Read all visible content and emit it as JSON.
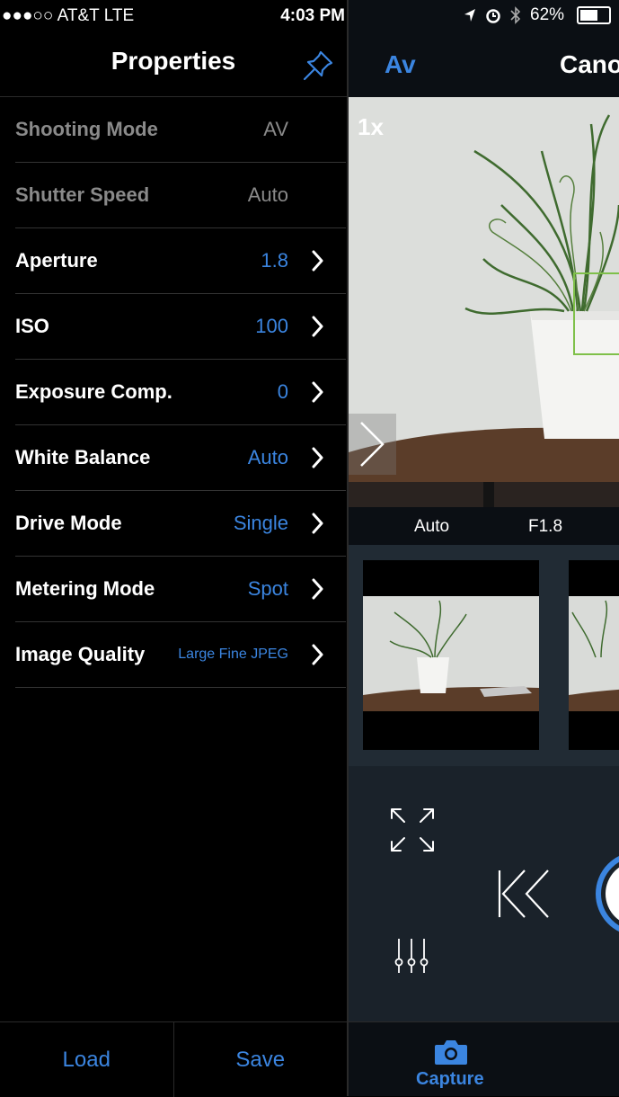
{
  "status_left": {
    "carrier": "●●●○○ AT&T  LTE",
    "time": "4:03 PM"
  },
  "status_right": {
    "battery": "62%",
    "battery_level": 0.62
  },
  "left_panel": {
    "title": "Properties",
    "rows": [
      {
        "label": "Shooting Mode",
        "value": "AV",
        "enabled": false
      },
      {
        "label": "Shutter Speed",
        "value": "Auto",
        "enabled": false
      },
      {
        "label": "Aperture",
        "value": "1.8",
        "enabled": true
      },
      {
        "label": "ISO",
        "value": "100",
        "enabled": true
      },
      {
        "label": "Exposure Comp.",
        "value": "0",
        "enabled": true
      },
      {
        "label": "White Balance",
        "value": "Auto",
        "enabled": true
      },
      {
        "label": "Drive Mode",
        "value": "Single",
        "enabled": true
      },
      {
        "label": "Metering Mode",
        "value": "Spot",
        "enabled": true
      },
      {
        "label": "Image Quality",
        "value": "Large Fine JPEG",
        "enabled": true
      }
    ],
    "bottom": {
      "load": "Load",
      "save": "Save"
    }
  },
  "right_panel": {
    "mode": "Av",
    "camera": "Cano",
    "zoom": "1x",
    "readout": {
      "wb": "Auto",
      "aperture": "F1.8"
    },
    "tab": {
      "label": "Capture"
    }
  },
  "colors": {
    "accent": "#3b85e0",
    "focus": "#7fc04a",
    "panel": "#1a222a"
  }
}
